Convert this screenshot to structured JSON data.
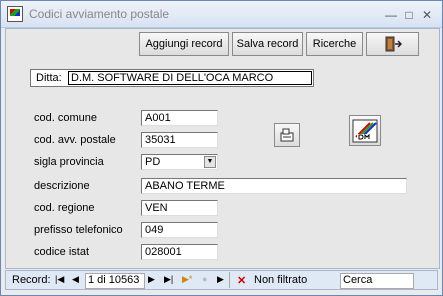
{
  "window": {
    "title": "Codici avviamento postale",
    "app_icon": "dm-app-icon"
  },
  "toolbar": {
    "add_label": "Aggiungi record",
    "save_label": "Salva record",
    "search_label": "Ricerche",
    "exit_icon": "exit-door-icon"
  },
  "ditta": {
    "label": "Ditta:",
    "value": "D.M. SOFTWARE DI DELL'OCA MARCO"
  },
  "form": {
    "cod_comune": {
      "label": "cod. comune",
      "value": "A001"
    },
    "cod_avv_postale": {
      "label": "cod. avv. postale",
      "value": "35031"
    },
    "sigla_provincia": {
      "label": "sigla provincia",
      "value": "PD"
    },
    "descrizione": {
      "label": "descrizione",
      "value": "ABANO TERME"
    },
    "cod_regione": {
      "label": "cod. regione",
      "value": "VEN"
    },
    "prefisso_telefonico": {
      "label": "prefisso telefonico",
      "value": "049"
    },
    "codice_istat": {
      "label": "codice istat",
      "value": "028001"
    }
  },
  "navigation": {
    "record_label": "Record:",
    "position": "1 di 10563",
    "filter_label": "Non filtrato",
    "search_placeholder": "Cerca"
  }
}
